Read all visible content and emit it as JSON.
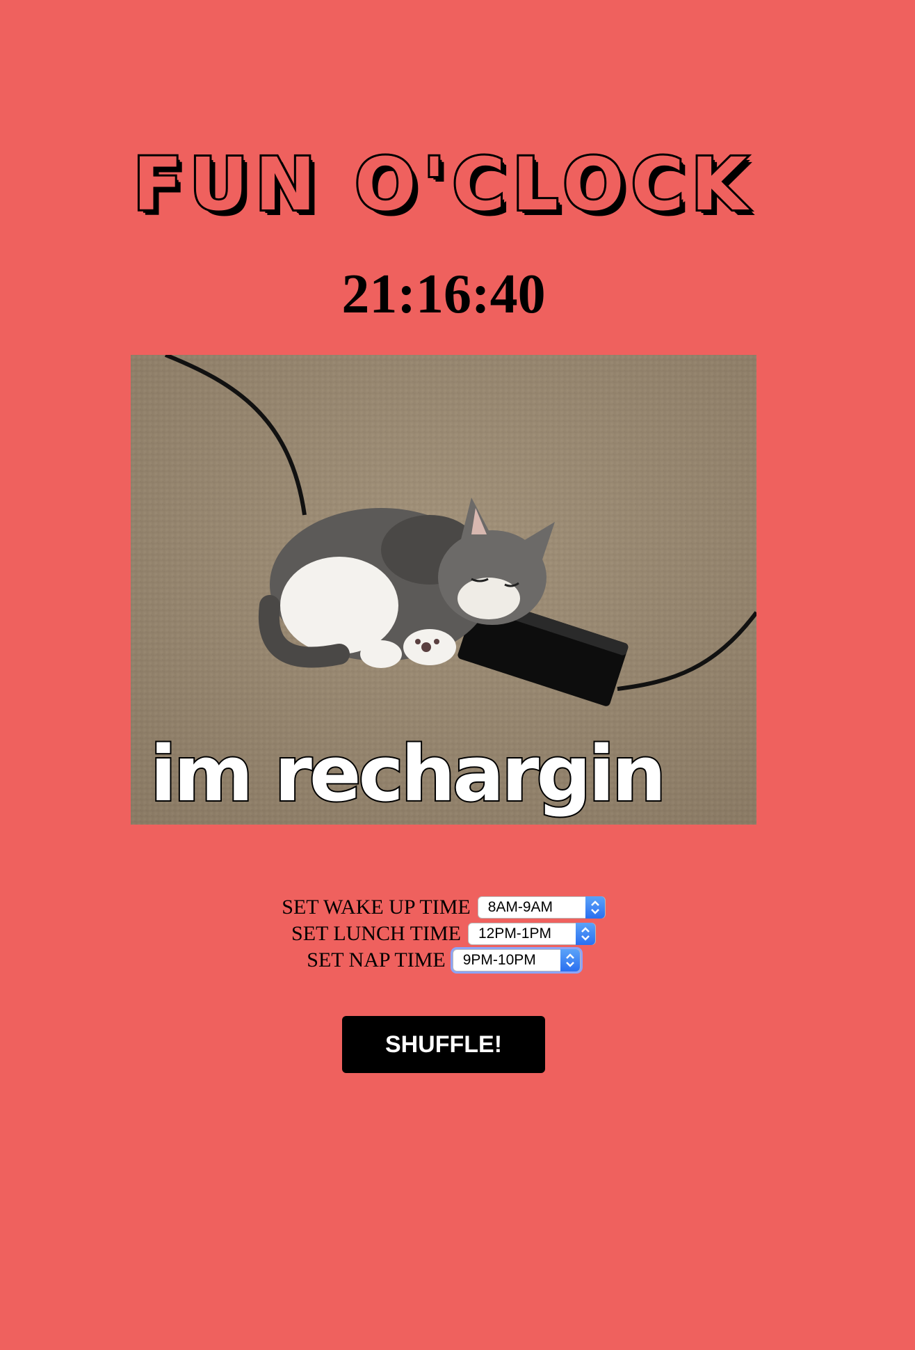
{
  "header": {
    "title": "FUN O'CLOCK",
    "clock": "21:16:40"
  },
  "image": {
    "caption": "im rechargin"
  },
  "controls": {
    "wake_up": {
      "label": "SET WAKE UP TIME",
      "value": "8AM-9AM"
    },
    "lunch": {
      "label": "SET LUNCH TIME",
      "value": "12PM-1PM"
    },
    "nap": {
      "label": "SET NAP TIME",
      "value": "9PM-10PM"
    }
  },
  "shuffle_label": "SHUFFLE!",
  "colors": {
    "background": "#ef615e",
    "button": "#000000",
    "select_accent": "#2f7cf6"
  },
  "icons": {
    "select_arrows": "chevron-up-down-icon"
  }
}
